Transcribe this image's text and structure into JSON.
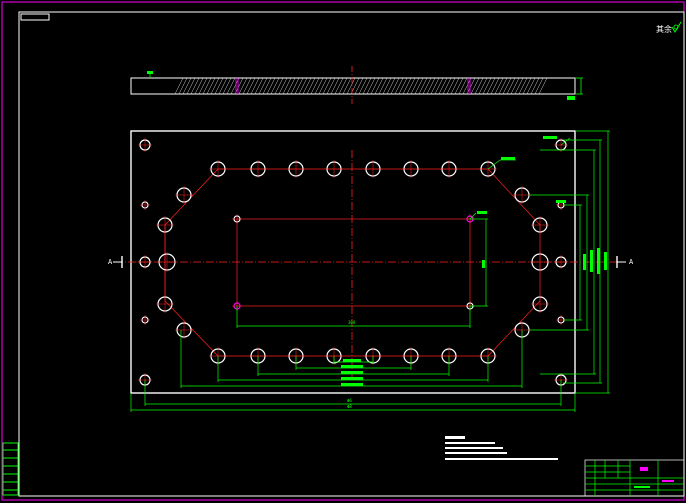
{
  "drawing": {
    "top_right_note": "其余",
    "section_left_label": "A",
    "section_right_label": "A",
    "dim_inner_width": "308",
    "dim_overall_width_1": "Φ6",
    "dim_overall_width_2": "Φ8",
    "notes_lines": 5
  },
  "colors": {
    "background": "#000000",
    "frame": "#ffffff",
    "centerline": "#ff2020",
    "dimension": "#00ff00",
    "hole": "#ffffff",
    "title_block": "#00ff00",
    "accent_pink": "#ff00ff"
  },
  "holes": {
    "top_row_count": 8,
    "bottom_row_count": 8,
    "side_large_count": 2,
    "corner_holes": 4
  }
}
